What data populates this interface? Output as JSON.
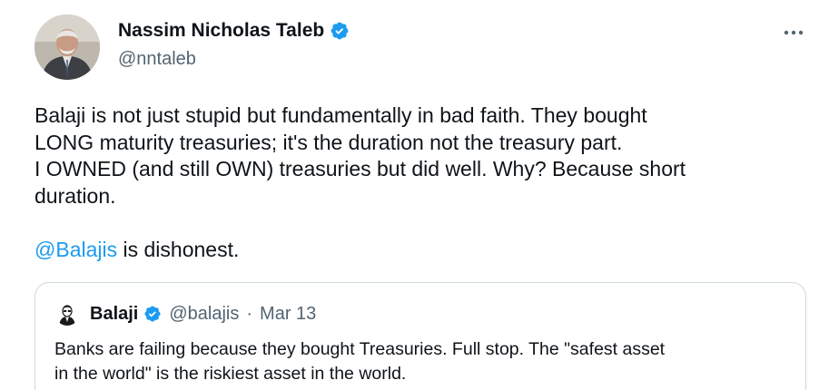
{
  "author": {
    "name": "Nassim Nicholas Taleb",
    "handle": "@nntaleb",
    "verified_color": "#1d9bf0"
  },
  "menu": {
    "icon": "more-horizontal-icon"
  },
  "tweet": {
    "lines": [
      "Balaji is not just stupid but fundamentally in bad faith. They bought",
      "LONG maturity treasuries; it's the duration not the treasury part.",
      "I OWNED (and still OWN) treasuries but did well. Why? Because short",
      "duration."
    ],
    "mention": "@Balajis",
    "mention_suffix": " is dishonest."
  },
  "quoted_tweet": {
    "name": "Balaji",
    "handle": "@balajis",
    "separator": "·",
    "date": "Mar 13",
    "lines": [
      "Banks are failing because they bought Treasuries. Full stop. The \"safest asset",
      "in the world\" is the riskiest asset in the world."
    ]
  },
  "colors": {
    "text": "#0f1419",
    "secondary": "#536471",
    "link": "#1d9bf0",
    "border": "#cfd9de"
  }
}
